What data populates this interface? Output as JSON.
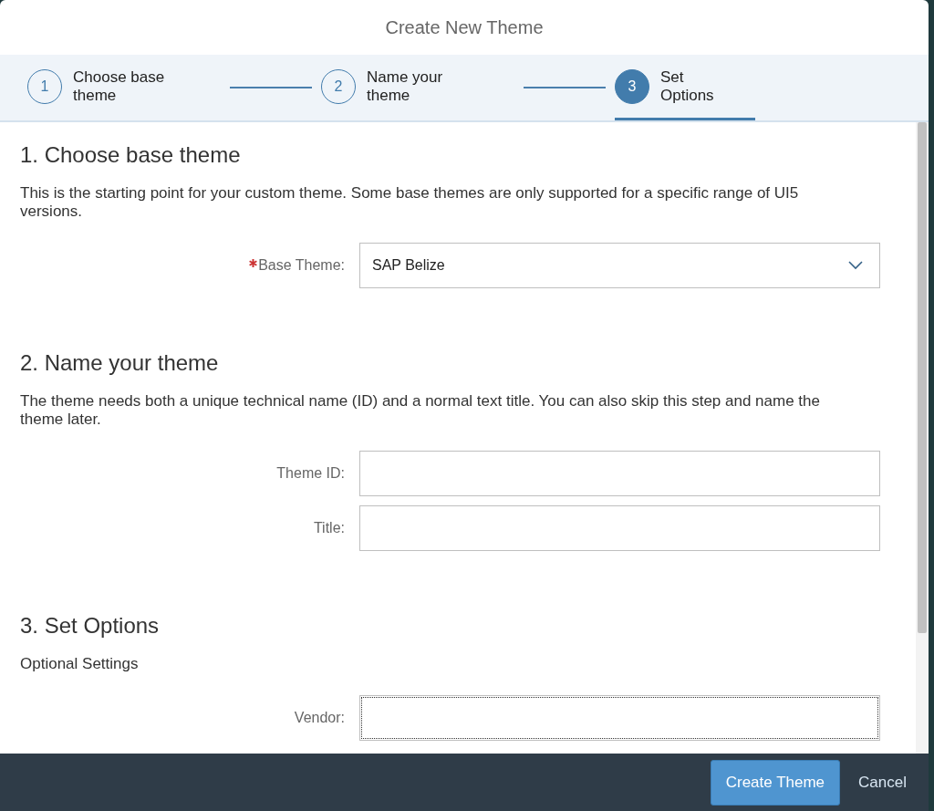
{
  "dialog": {
    "title": "Create New Theme"
  },
  "steps": [
    {
      "number": "1",
      "label": "Choose base theme",
      "selected": false
    },
    {
      "number": "2",
      "label": "Name your theme",
      "selected": false
    },
    {
      "number": "3",
      "label": "Set Options",
      "selected": true
    }
  ],
  "sections": [
    {
      "heading": "1. Choose base theme",
      "description": "This is the starting point for your custom theme. Some base themes are only supported for a specific range of UI5 versions.",
      "fields": [
        {
          "kind": "select",
          "label": "Base Theme:",
          "required": true,
          "value": "SAP Belize",
          "focused": false
        }
      ]
    },
    {
      "heading": "2. Name your theme",
      "description": "The theme needs both a unique technical name (ID) and a normal text title. You can also skip this step and name the theme later.",
      "fields": [
        {
          "kind": "text",
          "label": "Theme ID:",
          "required": false,
          "focused": false
        },
        {
          "kind": "text",
          "label": "Title:",
          "required": false,
          "focused": false
        }
      ]
    },
    {
      "heading": "3. Set Options",
      "description": "Optional Settings",
      "fields": [
        {
          "kind": "text",
          "label": "Vendor:",
          "required": false,
          "focused": true
        }
      ]
    }
  ],
  "footer": {
    "buttons": [
      {
        "label": "Create Theme",
        "kind": "primary"
      },
      {
        "label": "Cancel",
        "kind": "plain"
      }
    ]
  }
}
